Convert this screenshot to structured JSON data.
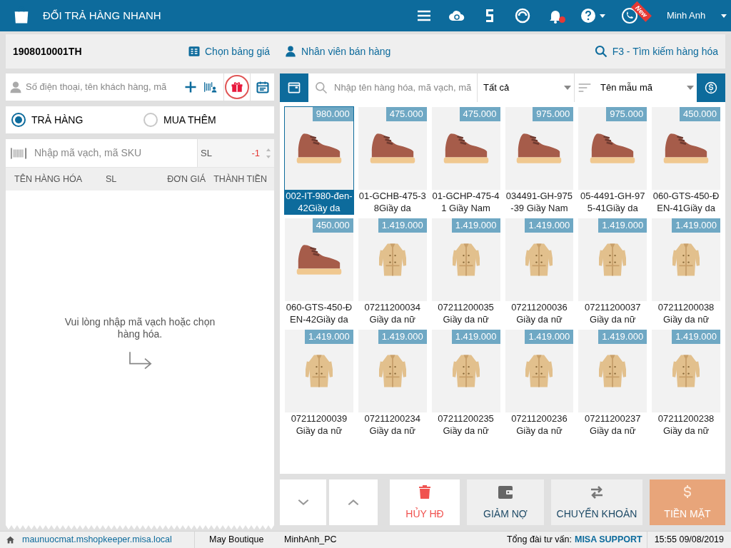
{
  "header": {
    "title": "ĐỔI TRẢ HÀNG NHANH",
    "new_badge": "New",
    "user": "Minh Anh",
    "notification": true
  },
  "toolbar": {
    "invoice_no": "1908010001TH",
    "price_list": "Chọn bảng giá",
    "staff": "Nhân viên bán hàng",
    "search": "F3 - Tìm kiếm hàng hóa"
  },
  "customer": {
    "placeholder": "Số điện thoại, tên khách hàng, mã"
  },
  "modes": [
    {
      "label": "TRẢ HÀNG",
      "selected": true
    },
    {
      "label": "MUA THÊM",
      "selected": false
    }
  ],
  "barcode": {
    "placeholder": "Nhập mã vạch, mã SKU",
    "qty_label": "SL",
    "qty": "-1"
  },
  "cart": {
    "columns": [
      "TÊN HÀNG HÓA",
      "SL",
      "ĐƠN GIÁ",
      "THÀNH TIỀN"
    ],
    "empty_message": "Vui lòng nhập mã vạch hoặc chọn hàng hóa."
  },
  "catalog": {
    "search_placeholder": "Nhập tên hàng hóa, mã vạch, mã",
    "filter": "Tất cả",
    "sort": "Tên mẫu mã",
    "items": [
      {
        "kind": "shoe",
        "price": "980.000",
        "name_lines": [
          "002-IT-980-đen-",
          "42Giầy da"
        ],
        "selected": true
      },
      {
        "kind": "shoe",
        "price": "475.000",
        "name_lines": [
          "01-GCHB-475-3",
          "8Giầy da"
        ],
        "selected": false
      },
      {
        "kind": "shoe",
        "price": "475.000",
        "name_lines": [
          "01-GCHP-475-4",
          "1 Giầy Nam"
        ],
        "selected": false
      },
      {
        "kind": "shoe",
        "price": "975.000",
        "name_lines": [
          "034491-GH-975",
          "-39 Giầy Nam"
        ],
        "selected": false
      },
      {
        "kind": "shoe",
        "price": "975.000",
        "name_lines": [
          "05-4491-GH-97",
          "5-41Giầy da"
        ],
        "selected": false
      },
      {
        "kind": "shoe",
        "price": "450.000",
        "name_lines": [
          "060-GTS-450-Đ",
          "EN-41Giầy da"
        ],
        "selected": false
      },
      {
        "kind": "shoe",
        "price": "450.000",
        "name_lines": [
          "060-GTS-450-Đ",
          "EN-42Giầy da"
        ],
        "selected": false
      },
      {
        "kind": "coat",
        "price": "1.419.000",
        "name_lines": [
          "07211200034",
          "Giầy da nữ"
        ],
        "selected": false
      },
      {
        "kind": "coat",
        "price": "1.419.000",
        "name_lines": [
          "07211200035",
          "Giầy da nữ"
        ],
        "selected": false
      },
      {
        "kind": "coat",
        "price": "1.419.000",
        "name_lines": [
          "07211200036",
          "Giầy da nữ"
        ],
        "selected": false
      },
      {
        "kind": "coat",
        "price": "1.419.000",
        "name_lines": [
          "07211200037",
          "Giầy da nữ"
        ],
        "selected": false
      },
      {
        "kind": "coat",
        "price": "1.419.000",
        "name_lines": [
          "07211200038",
          "Giầy da nữ"
        ],
        "selected": false
      },
      {
        "kind": "coat",
        "price": "1.419.000",
        "name_lines": [
          "07211200039",
          "Giầy da nữ"
        ],
        "selected": false
      },
      {
        "kind": "coat",
        "price": "1.419.000",
        "name_lines": [
          "07211200234",
          "Giầy da nữ"
        ],
        "selected": false
      },
      {
        "kind": "coat",
        "price": "1.419.000",
        "name_lines": [
          "07211200235",
          "Giầy da nữ"
        ],
        "selected": false
      },
      {
        "kind": "coat",
        "price": "1.419.000",
        "name_lines": [
          "07211200236",
          "Giầy da nữ"
        ],
        "selected": false
      },
      {
        "kind": "coat",
        "price": "1.419.000",
        "name_lines": [
          "07211200237",
          "Giầy da nữ"
        ],
        "selected": false
      },
      {
        "kind": "coat",
        "price": "1.419.000",
        "name_lines": [
          "07211200238",
          "Giầy da nữ"
        ],
        "selected": false
      }
    ]
  },
  "actions": [
    {
      "kind": "cancel",
      "label": "HỦY HĐ"
    },
    {
      "kind": "debt",
      "label": "GIẢM NỢ"
    },
    {
      "kind": "transfer",
      "label": "CHUYỂN KHOẢN"
    },
    {
      "kind": "cash",
      "label": "TIỀN MẶT"
    }
  ],
  "status_bar": {
    "host": "maunuocmat.mshopkeeper.misa.local",
    "store": "May Boutique",
    "machine": "MinhAnh_PC",
    "hotline_label": "Tổng đài tư vấn:",
    "hotline": "MISA SUPPORT",
    "datetime": "15:55 09/08/2019"
  }
}
